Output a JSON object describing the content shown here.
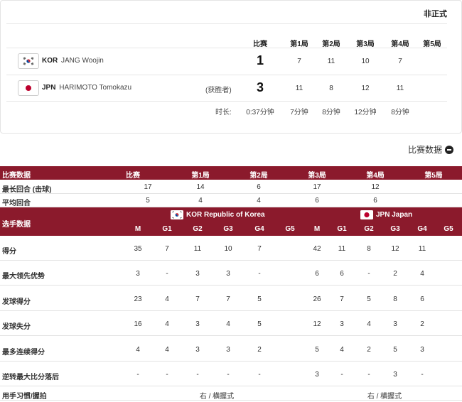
{
  "summary": {
    "unofficial": "非正式",
    "headers": [
      "比赛",
      "第1局",
      "第2局",
      "第3局",
      "第4局",
      "第5局"
    ],
    "players": [
      {
        "country": "KOR",
        "name": "JANG Woojin",
        "flag": "kor-flag-icon",
        "winner_tag": "",
        "match": "1",
        "games": [
          "7",
          "11",
          "10",
          "7",
          ""
        ]
      },
      {
        "country": "JPN",
        "name": "HARIMOTO Tomokazu",
        "flag": "jpn-flag-icon",
        "winner_tag": "(获胜者)",
        "match": "3",
        "games": [
          "11",
          "8",
          "12",
          "11",
          ""
        ]
      }
    ],
    "duration": {
      "label": "时长:",
      "match": "0:37分钟",
      "games": [
        "7分钟",
        "8分钟",
        "12分钟",
        "8分钟"
      ]
    }
  },
  "stats_toggle": {
    "label": "比赛数据",
    "icon": "minus-circle-icon"
  },
  "match_table": {
    "title": "比赛数据",
    "headers": [
      "比赛",
      "第1局",
      "第2局",
      "第3局",
      "第4局",
      "第5局"
    ],
    "rows": [
      {
        "label": "最长回合 (击球)",
        "values": [
          "17",
          "14",
          "6",
          "17",
          "12",
          ""
        ]
      },
      {
        "label": "平均回合",
        "values": [
          "5",
          "4",
          "4",
          "6",
          "6",
          ""
        ]
      }
    ]
  },
  "player_table": {
    "title": "选手数据",
    "teams": [
      {
        "label": "KOR Republic of Korea",
        "flag": "kor-flag-icon"
      },
      {
        "label": "JPN Japan",
        "flag": "jpn-flag-icon"
      }
    ],
    "sub_headers": [
      "M",
      "G1",
      "G2",
      "G3",
      "G4",
      "G5"
    ],
    "rows": [
      {
        "label": "得分",
        "kor": [
          "35",
          "7",
          "11",
          "10",
          "7",
          ""
        ],
        "jpn": [
          "42",
          "11",
          "8",
          "12",
          "11",
          ""
        ]
      },
      {
        "label": "最大领先优势",
        "kor": [
          "3",
          "-",
          "3",
          "3",
          "-",
          ""
        ],
        "jpn": [
          "6",
          "6",
          "-",
          "2",
          "4",
          ""
        ]
      },
      {
        "label": "发球得分",
        "kor": [
          "23",
          "4",
          "7",
          "7",
          "5",
          ""
        ],
        "jpn": [
          "26",
          "7",
          "5",
          "8",
          "6",
          ""
        ]
      },
      {
        "label": "发球失分",
        "kor": [
          "16",
          "4",
          "3",
          "4",
          "5",
          ""
        ],
        "jpn": [
          "12",
          "3",
          "4",
          "3",
          "2",
          ""
        ]
      },
      {
        "label": "最多连续得分",
        "kor": [
          "4",
          "4",
          "3",
          "3",
          "2",
          ""
        ],
        "jpn": [
          "5",
          "4",
          "2",
          "5",
          "3",
          ""
        ]
      },
      {
        "label": "逆转最大比分落后",
        "kor": [
          "-",
          "-",
          "-",
          "-",
          "-",
          ""
        ],
        "jpn": [
          "3",
          "-",
          "-",
          "3",
          "-",
          ""
        ]
      }
    ],
    "grip_row": {
      "label": "用手习惯/握拍",
      "kor": "右 / 横握式",
      "jpn": "右 / 横握式"
    }
  },
  "colors": {
    "header_bg": "#8b1a2c",
    "kor_red": "#cd2e3a",
    "kor_blue": "#0047a0",
    "jpn_red": "#bc002d"
  }
}
